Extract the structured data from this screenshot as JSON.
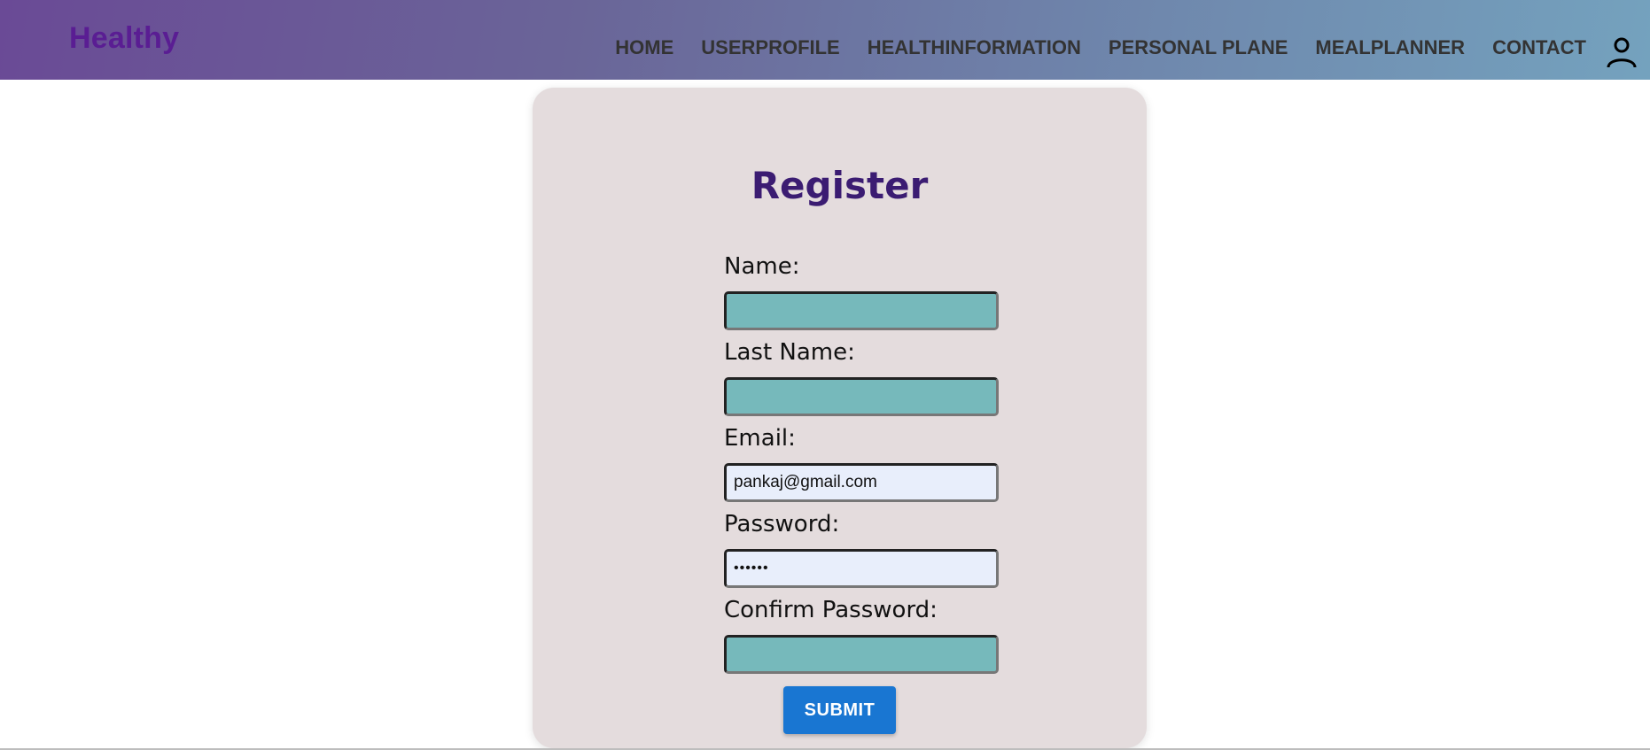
{
  "navbar": {
    "brand": "Healthy",
    "links": [
      "HOME",
      "USERPROFILE",
      "HEALTHINFORMATION",
      "PERSONAL PLANE",
      "MEALPLANNER",
      "CONTACT"
    ],
    "user_icon": "user-icon",
    "colors": {
      "gradient_start": "#6a4a96",
      "gradient_end": "#74a2be",
      "brand_text": "#5a1d93",
      "link_text": "#333333"
    }
  },
  "register": {
    "title": "Register",
    "fields": [
      {
        "label": "Name:",
        "value": "",
        "placeholder": ""
      },
      {
        "label": "Last Name:",
        "value": "",
        "placeholder": ""
      },
      {
        "label": "Email:",
        "value": "pankaj@gmail.com",
        "placeholder": ""
      },
      {
        "label": "Password:",
        "value": "••••••",
        "placeholder": ""
      },
      {
        "label": "Confirm Password:",
        "value": "",
        "placeholder": ""
      }
    ],
    "submit_label": "SUBMIT",
    "colors": {
      "card_bg": "#e4dcdd",
      "title": "#3b1c72",
      "input_empty_bg": "#76b9bb",
      "input_filled_bg": "#e8eefb",
      "submit_bg": "#1976d2"
    }
  }
}
